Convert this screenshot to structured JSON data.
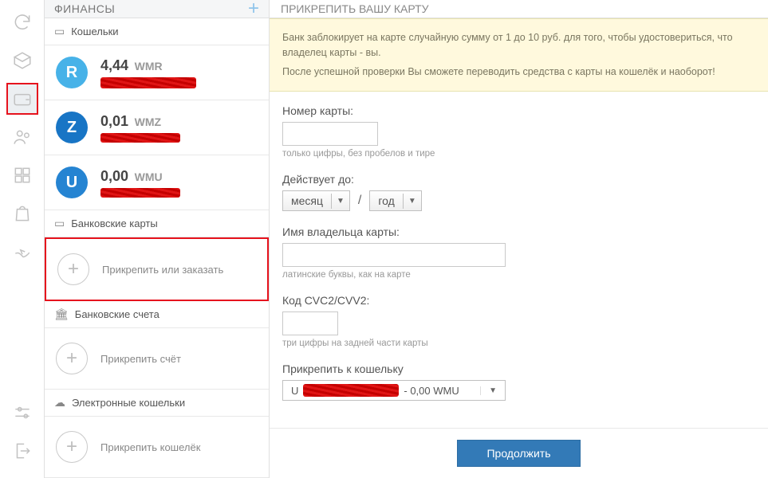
{
  "sidebar": {
    "title": "ФИНАНСЫ",
    "sections": {
      "wallets": "Кошельки",
      "cards": "Банковские карты",
      "accounts": "Банковские счета",
      "ewallets": "Электронные кошельки"
    },
    "wallets": [
      {
        "letter": "R",
        "amount": "4,44",
        "currency": "WMR"
      },
      {
        "letter": "Z",
        "amount": "0,01",
        "currency": "WMZ"
      },
      {
        "letter": "U",
        "amount": "0,00",
        "currency": "WMU"
      }
    ],
    "attach_card": "Прикрепить или заказать",
    "attach_account": "Прикрепить счёт",
    "attach_ewallet": "Прикрепить кошелёк"
  },
  "main": {
    "title": "ПРИКРЕПИТЬ ВАШУ КАРТУ",
    "notice_line1": "Банк заблокирует на карте случайную сумму от 1 до 10 руб. для того, чтобы удостовериться, что владелец карты - вы.",
    "notice_line2": "После успешной проверки Вы сможете переводить средства с карты на кошелёк и наоборот!",
    "form": {
      "card_number_label": "Номер карты:",
      "card_number_hint": "только цифры, без пробелов и тире",
      "expires_label": "Действует до:",
      "month": "месяц",
      "year": "год",
      "holder_label": "Имя владельца карты:",
      "holder_hint": "латинские буквы, как на карте",
      "cvc_label": "Код CVC2/CVV2:",
      "cvc_hint": "три цифры на задней части карты",
      "attach_to_label": "Прикрепить к кошельку",
      "attach_to_prefix": "U",
      "attach_to_suffix": " - 0,00 WMU",
      "submit": "Продолжить"
    }
  }
}
